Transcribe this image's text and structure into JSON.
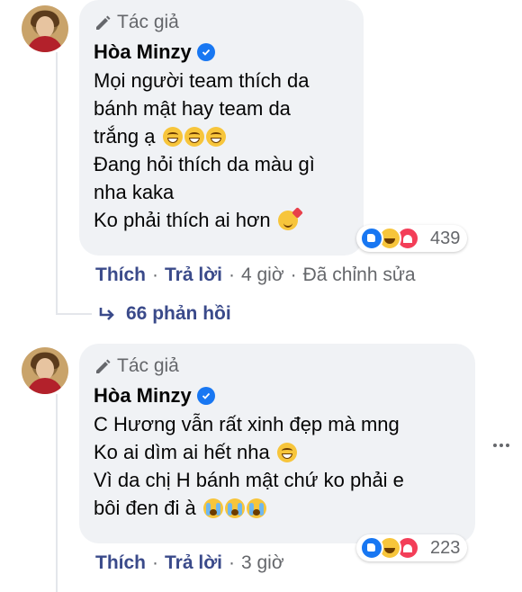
{
  "colors": {
    "bubble": "#f0f2f5",
    "meta_text": "#65676b",
    "action_text": "#3a4a8a",
    "verified": "#1877f2",
    "thread_line": "#e4e6eb"
  },
  "comments": [
    {
      "badge": "Tác giả",
      "author": "Hòa Minzy",
      "lines": [
        "Mọi người team thích da",
        "bánh mật hay team da",
        "trắng ạ",
        "Đang hỏi thích da màu gì",
        "nha kaka",
        "Ko phải thích ai hơn"
      ],
      "reaction_count": "439",
      "actions": {
        "like": "Thích",
        "reply": "Trả lời",
        "time": "4 giờ",
        "edited": "Đã chỉnh sửa"
      },
      "replies_label": "66 phản hồi"
    },
    {
      "badge": "Tác giả",
      "author": "Hòa Minzy",
      "lines": [
        "C Hương vẫn rất xinh đẹp mà mng",
        "Ko ai dìm ai hết nha",
        "Vì da chị H bánh mật chứ ko phải e",
        "bôi đen đi à"
      ],
      "reaction_count": "223",
      "actions": {
        "like": "Thích",
        "reply": "Trả lời",
        "time": "3 giờ"
      }
    }
  ]
}
